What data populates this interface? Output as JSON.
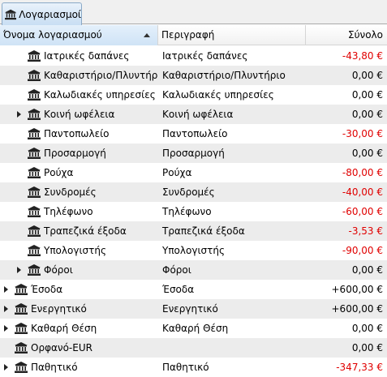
{
  "tab": {
    "label": "Λογαριασμοί",
    "icon": "bank-icon"
  },
  "columns": {
    "name": "Όνομα λογαριασμού",
    "description": "Περιγραφή",
    "total": "Σύνολο"
  },
  "colors": {
    "negative": "#e00000",
    "alt_row": "#ececec"
  },
  "rows": [
    {
      "name": "Ιατρικές δαπάνες",
      "description": "Ιατρικές δαπάνες",
      "total": "-43,80 €",
      "negative": true,
      "level": 1,
      "expandable": false
    },
    {
      "name": "Καθαριστήριο/Πλυντήριο",
      "description": "Καθαριστήριο/Πλυντήριο",
      "total": "0,00 €",
      "negative": false,
      "level": 1,
      "expandable": false
    },
    {
      "name": "Καλωδιακές υπηρεσίες",
      "description": "Καλωδιακές υπηρεσίες",
      "total": "0,00 €",
      "negative": false,
      "level": 1,
      "expandable": false
    },
    {
      "name": "Κοινή ωφέλεια",
      "description": "Κοινή ωφέλεια",
      "total": "0,00 €",
      "negative": false,
      "level": 1,
      "expandable": true
    },
    {
      "name": "Παντοπωλείο",
      "description": "Παντοπωλείο",
      "total": "-30,00 €",
      "negative": true,
      "level": 1,
      "expandable": false
    },
    {
      "name": "Προσαρμογή",
      "description": "Προσαρμογή",
      "total": "0,00 €",
      "negative": false,
      "level": 1,
      "expandable": false
    },
    {
      "name": "Ρούχα",
      "description": "Ρούχα",
      "total": "-80,00 €",
      "negative": true,
      "level": 1,
      "expandable": false
    },
    {
      "name": "Συνδρομές",
      "description": "Συνδρομές",
      "total": "-40,00 €",
      "negative": true,
      "level": 1,
      "expandable": false
    },
    {
      "name": "Τηλέφωνο",
      "description": "Τηλέφωνο",
      "total": "-60,00 €",
      "negative": true,
      "level": 1,
      "expandable": false
    },
    {
      "name": "Τραπεζικά έξοδα",
      "description": "Τραπεζικά έξοδα",
      "total": "-3,53 €",
      "negative": true,
      "level": 1,
      "expandable": false
    },
    {
      "name": "Υπολογιστής",
      "description": "Υπολογιστής",
      "total": "-90,00 €",
      "negative": true,
      "level": 1,
      "expandable": false
    },
    {
      "name": "Φόροι",
      "description": "Φόροι",
      "total": "0,00 €",
      "negative": false,
      "level": 1,
      "expandable": true
    },
    {
      "name": "Έσοδα",
      "description": "Έσοδα",
      "total": "+600,00 €",
      "negative": false,
      "level": 0,
      "expandable": true
    },
    {
      "name": "Ενεργητικό",
      "description": "Ενεργητικό",
      "total": "+600,00 €",
      "negative": false,
      "level": 0,
      "expandable": true
    },
    {
      "name": "Καθαρή Θέση",
      "description": "Καθαρή Θέση",
      "total": "0,00 €",
      "negative": false,
      "level": 0,
      "expandable": true
    },
    {
      "name": "Ορφανό-EUR",
      "description": "",
      "total": "0,00 €",
      "negative": false,
      "level": 0,
      "expandable": false
    },
    {
      "name": "Παθητικό",
      "description": "Παθητικό",
      "total": "-347,33 €",
      "negative": true,
      "level": 0,
      "expandable": true
    }
  ]
}
